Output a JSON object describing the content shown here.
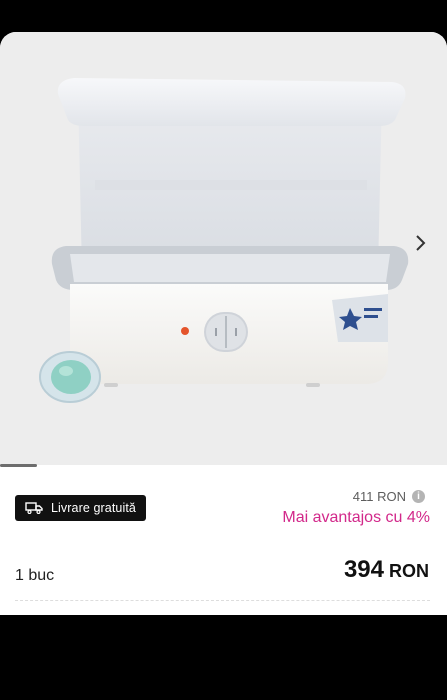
{
  "product": {
    "image_icon": "bottle-sterilizer-product-photo",
    "next_icon": "chevron-right-icon",
    "gallery_position": 0.08
  },
  "delivery": {
    "label": "Livrare gratuită",
    "icon": "truck-icon"
  },
  "pricing": {
    "old_price": "411 RON",
    "info_icon": "info-icon",
    "promo": "Mai avantajos cu 4%",
    "quantity": "1 buc",
    "price": "394",
    "currency": "RON"
  },
  "colors": {
    "promo": "#d2288a",
    "badge_bg": "#111111",
    "gallery_bg": "#ededed"
  }
}
